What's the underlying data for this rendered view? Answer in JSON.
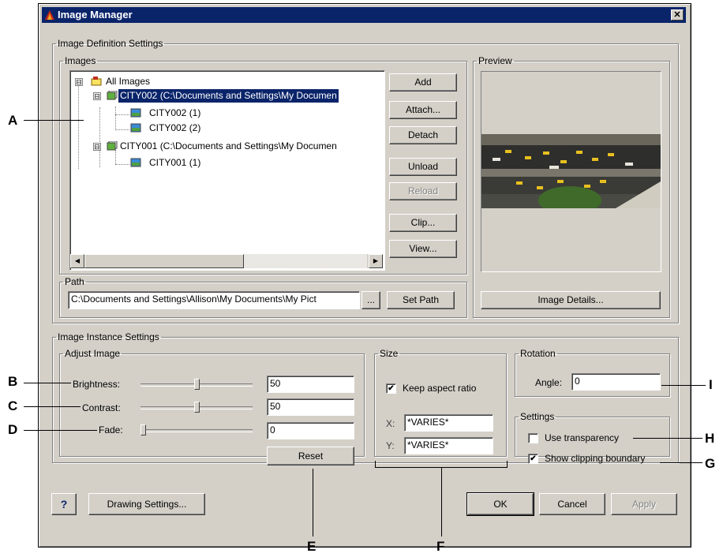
{
  "window": {
    "title": "Image Manager",
    "close_glyph": "✕"
  },
  "image_definition": {
    "legend": "Image Definition Settings",
    "images_legend": "Images",
    "tree": [
      {
        "label": "All Images",
        "expander": "⊟"
      },
      {
        "label": "CITY002  (C:\\Documents and Settings\\My Documen",
        "expander": "⊟",
        "selected": true
      },
      {
        "label": "CITY002 (1)"
      },
      {
        "label": "CITY002 (2)"
      },
      {
        "label": "CITY001  (C:\\Documents and Settings\\My Documen",
        "expander": "⊟"
      },
      {
        "label": "CITY001 (1)"
      }
    ],
    "buttons": {
      "add": "Add",
      "attach": "Attach...",
      "detach": "Detach",
      "unload": "Unload",
      "reload": "Reload",
      "clip": "Clip...",
      "view": "View..."
    },
    "path_legend": "Path",
    "path_value": "C:\\Documents and Settings\\Allison\\My Documents\\My Pict",
    "browse_label": "...",
    "set_path_label": "Set Path",
    "preview_legend": "Preview",
    "image_details_label": "Image Details..."
  },
  "image_instance": {
    "legend": "Image Instance Settings",
    "adjust_legend": "Adjust Image",
    "brightness": {
      "label": "Brightness:",
      "value": "50",
      "level": 0.5
    },
    "contrast": {
      "label": "Contrast:",
      "value": "50",
      "level": 0.5
    },
    "fade": {
      "label": "Fade:",
      "value": "0",
      "level": 0.0
    },
    "reset_label": "Reset",
    "size_legend": "Size",
    "keep_aspect": {
      "label": "Keep aspect ratio",
      "checked": true
    },
    "x_label": "X:",
    "x_value": "*VARIES*",
    "y_label": "Y:",
    "y_value": "*VARIES*",
    "rotation_legend": "Rotation",
    "angle_label": "Angle:",
    "angle_value": "0",
    "settings_legend": "Settings",
    "use_transparency": {
      "label": "Use transparency",
      "checked": false
    },
    "show_clip": {
      "label": "Show clipping boundary",
      "checked": true
    }
  },
  "footer": {
    "help_label": "?",
    "drawing_settings_label": "Drawing Settings...",
    "ok_label": "OK",
    "cancel_label": "Cancel",
    "apply_label": "Apply"
  },
  "callouts": {
    "a": "A",
    "b": "B",
    "c": "C",
    "d": "D",
    "e": "E",
    "f": "F",
    "g": "G",
    "h": "H",
    "i": "I"
  },
  "colors": {
    "dialog_bg": "#d4d0c8",
    "title_bg": "#0a246a",
    "selection_bg": "#0a246a"
  }
}
